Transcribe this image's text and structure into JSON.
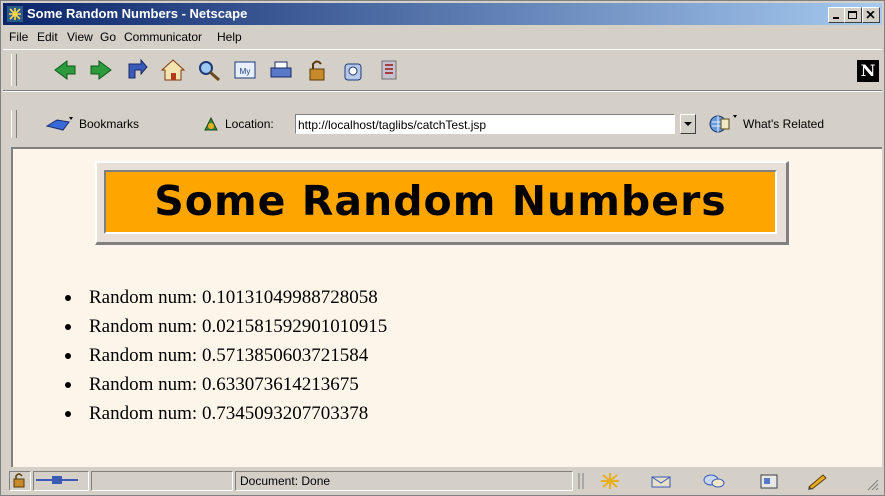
{
  "window": {
    "title": "Some Random Numbers - Netscape"
  },
  "menu": [
    "File",
    "Edit",
    "View",
    "Go",
    "Communicator",
    "Help"
  ],
  "navigation": {
    "bookmarks_label": "Bookmarks",
    "location_label": "Location:",
    "url": "http://localhost/taglibs/catchTest.jsp",
    "whats_related": "What's Related"
  },
  "toolbar": {
    "icons": [
      "back-icon",
      "forward-icon",
      "reload-icon",
      "home-icon",
      "search-icon",
      "my-netscape-icon",
      "print-icon",
      "security-icon",
      "shop-icon",
      "stop-icon"
    ],
    "netscape_logo": "N"
  },
  "page": {
    "heading": "Some Random Numbers",
    "items": [
      "Random num: 0.10131049988728058",
      "Random num: 0.021581592901010915",
      "Random num: 0.5713850603721584",
      "Random num: 0.633073614213675",
      "Random num: 0.7345093207703378"
    ]
  },
  "status": {
    "text": "Document: Done"
  },
  "colors": {
    "titlebar": "#0a246a",
    "banner": "#ffa500",
    "page_background": "#fdf5ea"
  }
}
